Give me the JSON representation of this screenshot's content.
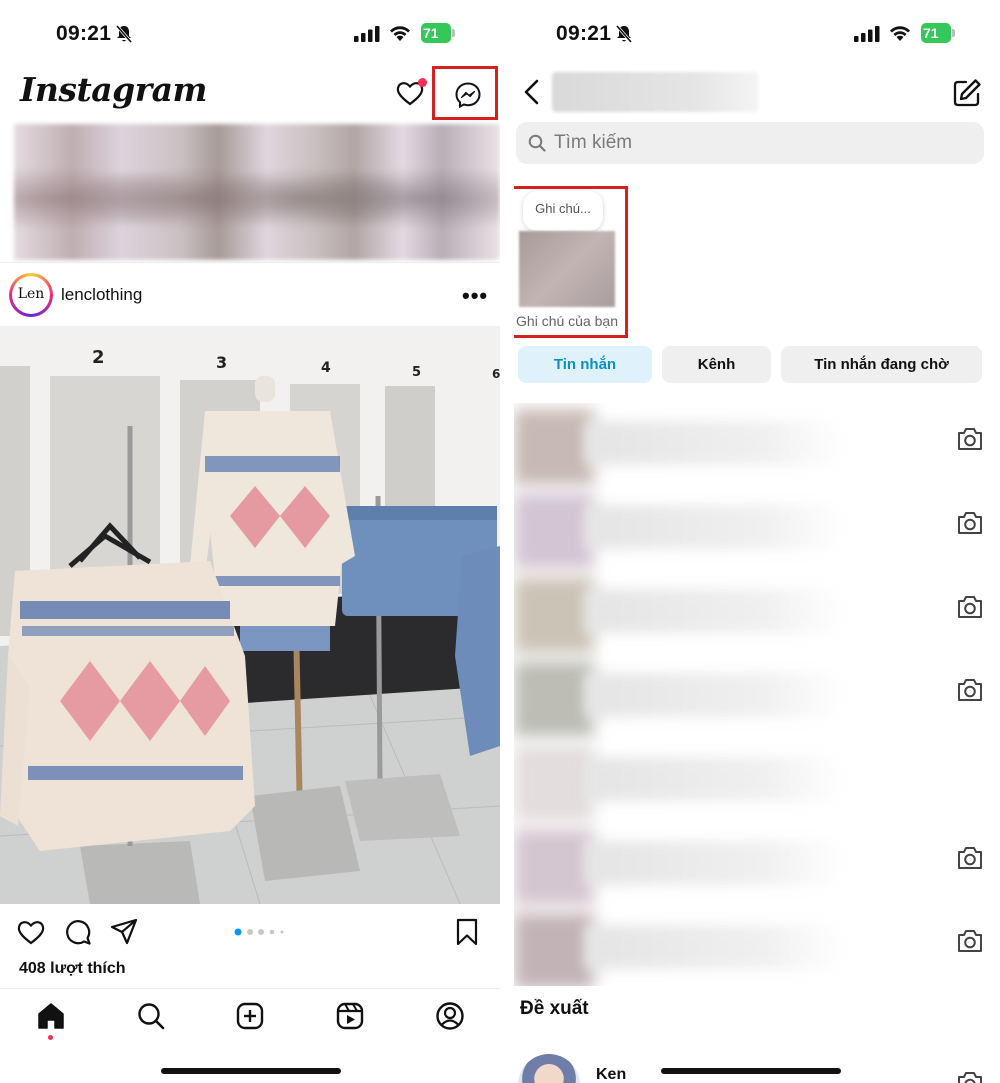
{
  "left": {
    "status": {
      "time": "09:21",
      "battery": "71"
    },
    "header": {
      "logo": "Instagram"
    },
    "post": {
      "username": "lenclothing",
      "avatar_text": "Len",
      "likes": "408 lượt thích"
    },
    "photo": {
      "rack_numbers": [
        "2",
        "3",
        "4",
        "5",
        "6"
      ]
    }
  },
  "right": {
    "status": {
      "time": "09:21",
      "battery": "71"
    },
    "search": {
      "placeholder": "Tìm kiếm"
    },
    "note": {
      "bubble": "Ghi chú...",
      "label": "Ghi chú của bạn"
    },
    "tabs": [
      {
        "label": "Tin nhắn"
      },
      {
        "label": "Kênh"
      },
      {
        "label": "Tin nhắn đang chờ"
      }
    ],
    "suggestions": {
      "title": "Đề xuất",
      "first_name": "Ken"
    }
  },
  "colors": {
    "highlight_box": "#d61f1f",
    "notification": "#ff2d55",
    "tab_active_bg": "#dff2fb",
    "tab_active_text": "#0a91c6",
    "battery": "#34c759"
  }
}
